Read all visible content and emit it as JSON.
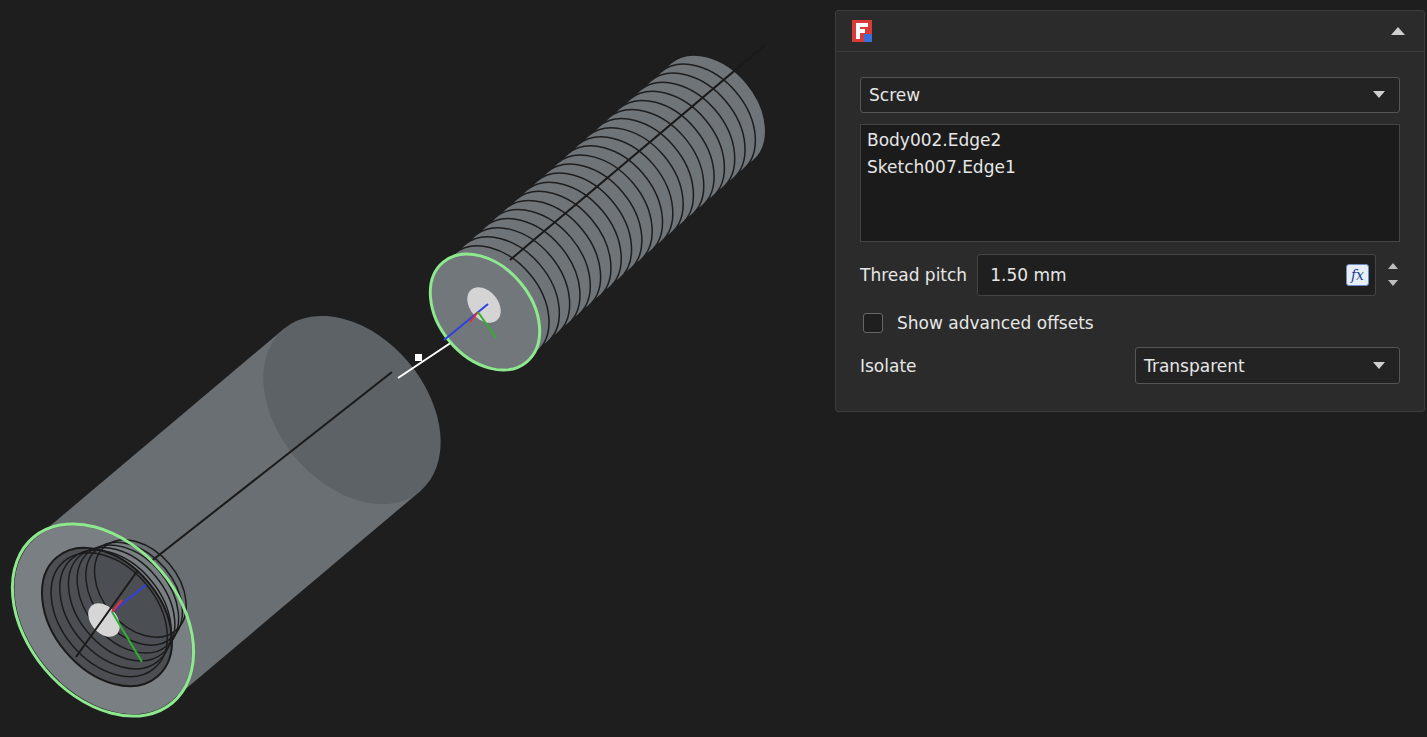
{
  "panel": {
    "collapsed": false,
    "type_dropdown": {
      "value": "Screw"
    },
    "references": [
      {
        "text": "Body002.Edge2",
        "highlighted": true
      },
      {
        "text": "Sketch007.Edge1",
        "highlighted": true
      }
    ],
    "thread_pitch": {
      "label": "Thread pitch",
      "value": "1.50 mm",
      "formula_button": "fx"
    },
    "advanced_offsets": {
      "label": "Show advanced offsets",
      "checked": false
    },
    "isolate": {
      "label": "Isolate",
      "value": "Transparent"
    }
  }
}
